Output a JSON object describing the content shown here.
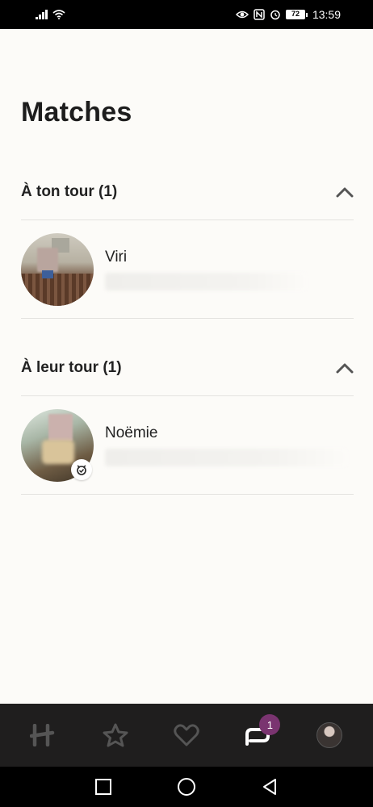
{
  "status_bar": {
    "time": "13:59",
    "battery": "72"
  },
  "page": {
    "title": "Matches"
  },
  "sections": [
    {
      "title": "À ton tour (1)",
      "matches": [
        {
          "name": "Viri"
        }
      ]
    },
    {
      "title": "À leur tour (1)",
      "matches": [
        {
          "name": "Noëmie",
          "verified": true
        }
      ]
    }
  ],
  "bottom_nav": {
    "items": [
      {
        "icon": "hinge-logo-icon"
      },
      {
        "icon": "star-icon"
      },
      {
        "icon": "heart-icon"
      },
      {
        "icon": "chat-icon",
        "badge": "1",
        "active": true
      },
      {
        "icon": "profile-avatar"
      }
    ]
  },
  "colors": {
    "background": "#fcfbf8",
    "nav_background": "#1f1e1e",
    "badge": "#7a3470"
  }
}
